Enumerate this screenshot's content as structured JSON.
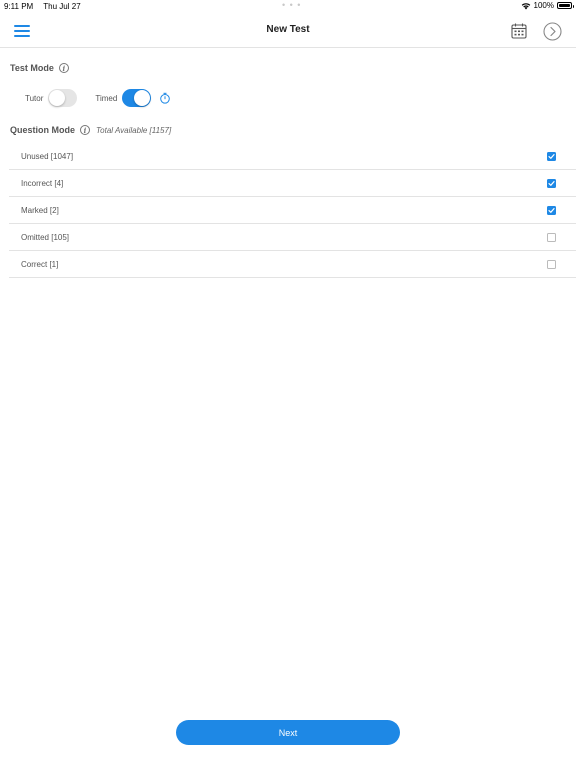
{
  "status_bar": {
    "time": "9:11 PM",
    "date": "Thu Jul 27",
    "dots": "• • •",
    "battery_percent": "100%"
  },
  "nav": {
    "title": "New Test",
    "menu_icon": "hamburger-menu-icon",
    "calendar_icon": "calendar-icon",
    "forward_icon": "chevron-right-circle-icon"
  },
  "test_mode": {
    "label": "Test Mode",
    "tutor_label": "Tutor",
    "tutor_on": false,
    "timed_label": "Timed",
    "timed_on": true
  },
  "question_mode": {
    "label": "Question Mode",
    "total_available": "Total Available [1157]",
    "items": [
      {
        "label": "Unused [1047]",
        "checked": true
      },
      {
        "label": "Incorrect [4]",
        "checked": true
      },
      {
        "label": "Marked [2]",
        "checked": true
      },
      {
        "label": "Omitted [105]",
        "checked": false
      },
      {
        "label": "Correct [1]",
        "checked": false
      }
    ]
  },
  "next_button": {
    "label": "Next"
  },
  "colors": {
    "accent": "#1e88e5",
    "divider": "#e3e3e3",
    "toggle_off": "#e5e5e5"
  }
}
